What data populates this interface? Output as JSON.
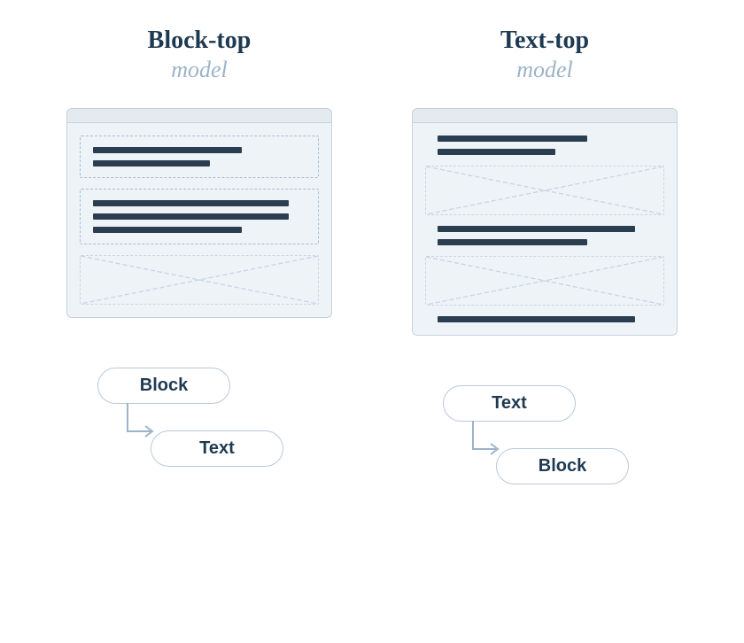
{
  "left": {
    "title": "Block-top",
    "subtitle": "model",
    "pill_top": "Block",
    "pill_child": "Text"
  },
  "right": {
    "title": "Text-top",
    "subtitle": "model",
    "pill_top": "Text",
    "pill_child": "Block"
  }
}
